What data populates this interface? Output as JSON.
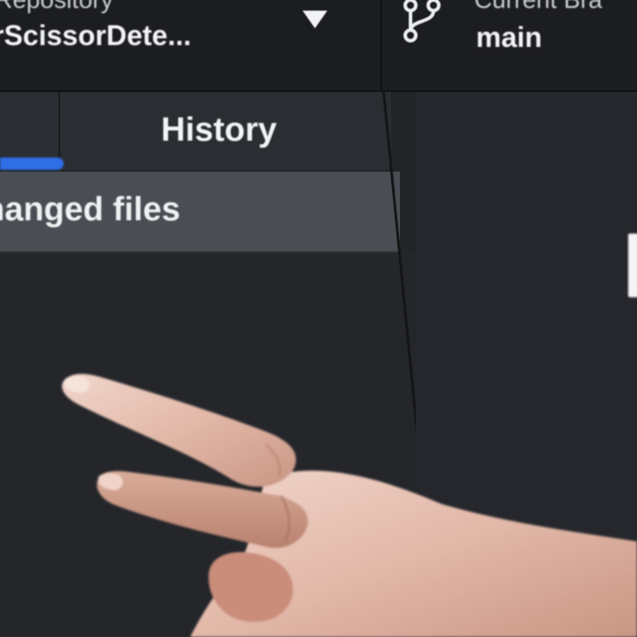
{
  "toolbar": {
    "repository": {
      "caption": "Repository",
      "name": "rScissorDete...",
      "dropdown_icon": "caret-down-icon"
    },
    "branch": {
      "icon": "git-branch-icon",
      "caption": "Current Bra",
      "name": "main"
    }
  },
  "tabs": {
    "changes": {
      "active": true,
      "indicator_color": "#2f6ee6"
    },
    "history": {
      "label": "History"
    }
  },
  "changes_panel": {
    "header_label": "hanged files"
  },
  "colors": {
    "background": "#25272b",
    "toolbar": "#1c1d20",
    "tab_bar": "#2a2d31",
    "header_row": "#4a4d53",
    "accent": "#2f6ee6",
    "text": "#f2f3f5"
  }
}
